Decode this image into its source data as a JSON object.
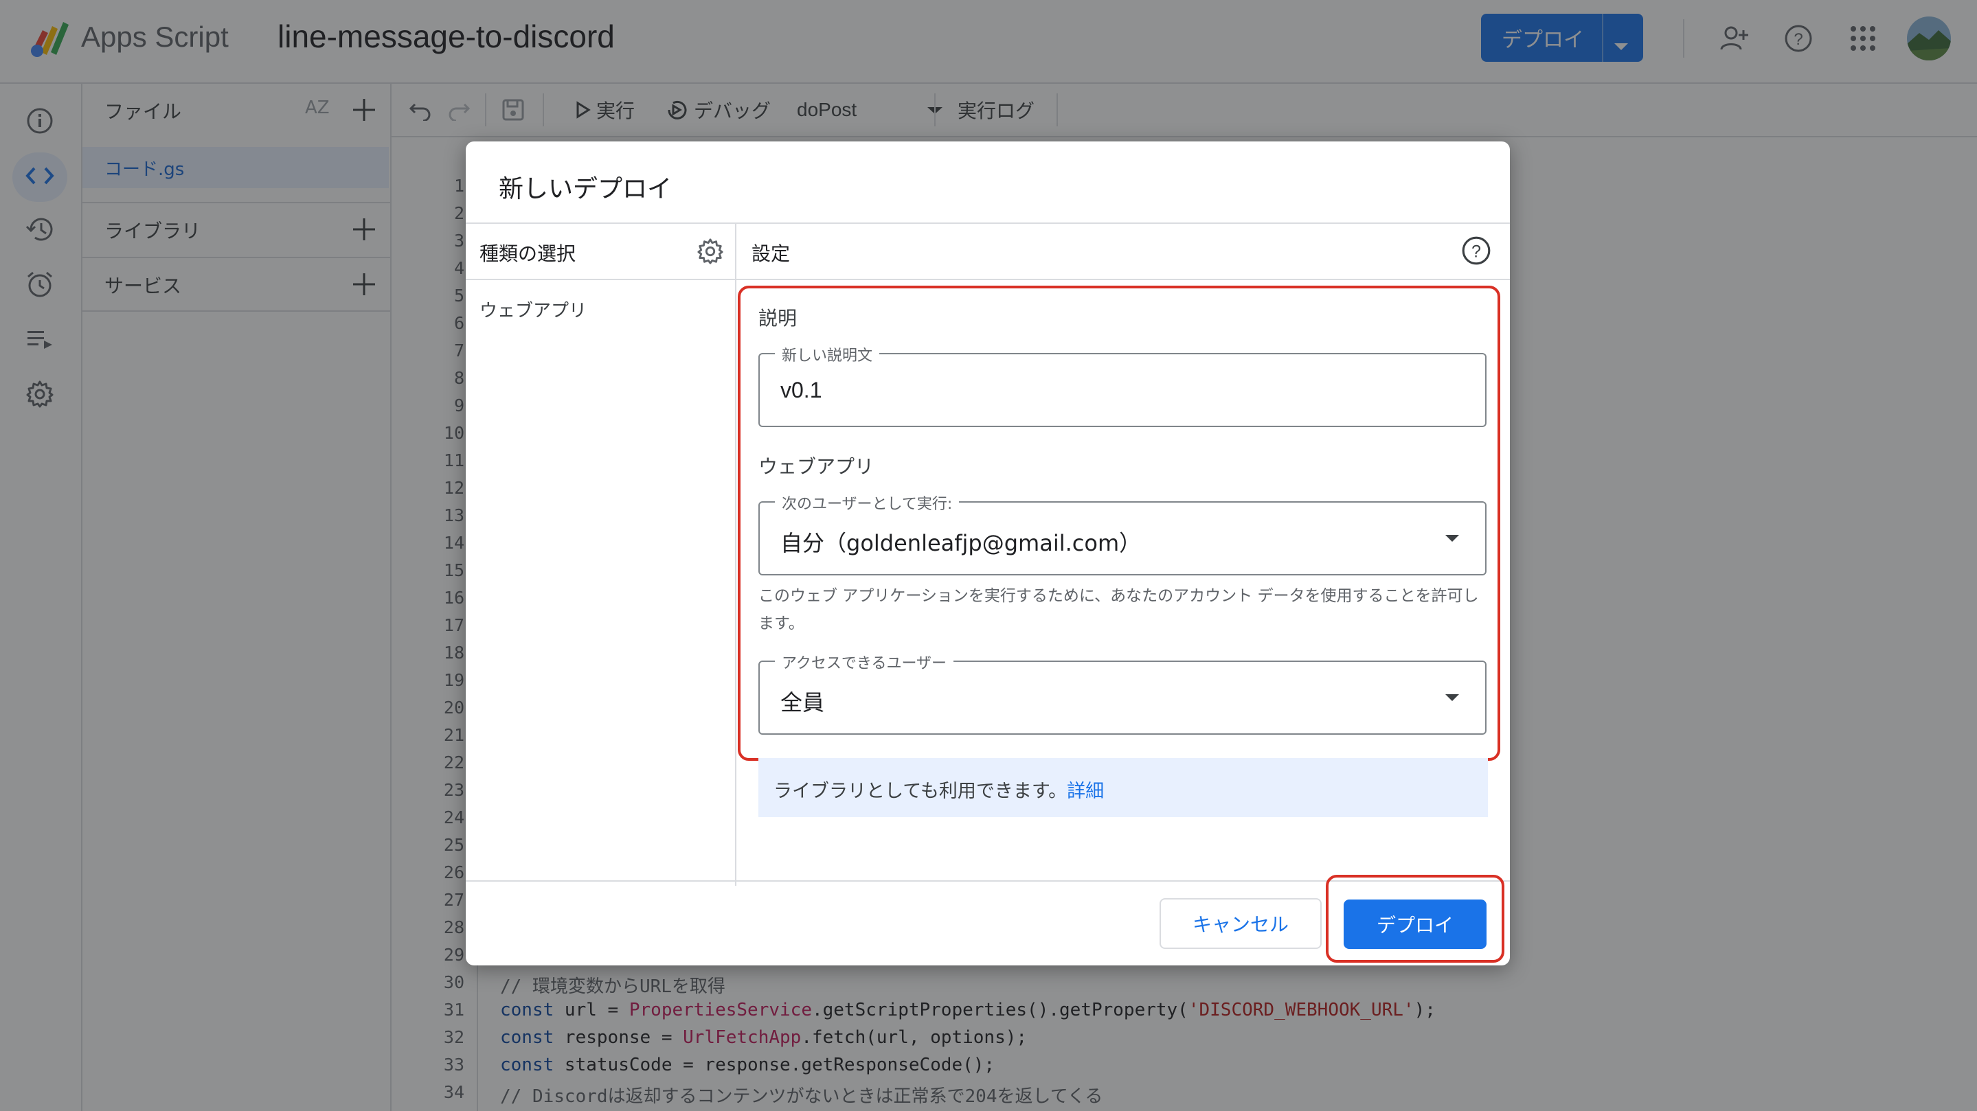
{
  "header": {
    "app_name": "Apps Script",
    "project_title": "line-message-to-discord",
    "deploy_label": "デプロイ",
    "icons": [
      "add-person-icon",
      "help-icon",
      "apps-grid-icon",
      "avatar"
    ]
  },
  "rail": {
    "items": [
      "info-icon",
      "code-icon",
      "history-icon",
      "alarm-icon",
      "executions-icon",
      "settings-icon"
    ],
    "active": "code-icon"
  },
  "file_panel": {
    "files_label": "ファイル",
    "sort_label": "AZ",
    "files": [
      {
        "name": "コード.gs",
        "selected": true
      }
    ],
    "libraries_label": "ライブラリ",
    "services_label": "サービス"
  },
  "toolbar": {
    "run_label": "実行",
    "debug_label": "デバッグ",
    "function_name": "doPost",
    "log_label": "実行ログ"
  },
  "editor": {
    "line_numbers": [
      "1",
      "2",
      "3",
      "4",
      "5",
      "6",
      "7",
      "8",
      "9",
      "10",
      "11",
      "12",
      "13",
      "14",
      "15",
      "16",
      "17",
      "18",
      "19",
      "20",
      "21",
      "22",
      "23",
      "24",
      "25",
      "26",
      "27",
      "28",
      "29",
      "30",
      "31",
      "32",
      "33",
      "34"
    ],
    "code_lines": [
      {
        "line": "30",
        "parts": [
          {
            "t": "// 環境変数からURLを取得",
            "c": "cm"
          }
        ]
      },
      {
        "line": "31",
        "parts": [
          {
            "t": "const",
            "c": "kw"
          },
          {
            "t": " url = ",
            "c": ""
          },
          {
            "t": "PropertiesService",
            "c": "cls"
          },
          {
            "t": ".getScriptProperties().getProperty(",
            "c": ""
          },
          {
            "t": "'DISCORD_WEBHOOK_URL'",
            "c": "str"
          },
          {
            "t": ");",
            "c": ""
          }
        ]
      },
      {
        "line": "32",
        "parts": [
          {
            "t": "const",
            "c": "kw"
          },
          {
            "t": " response = ",
            "c": ""
          },
          {
            "t": "UrlFetchApp",
            "c": "cls"
          },
          {
            "t": ".fetch(url, options);",
            "c": ""
          }
        ]
      },
      {
        "line": "33",
        "parts": [
          {
            "t": "const",
            "c": "kw"
          },
          {
            "t": " statusCode = response.getResponseCode();",
            "c": ""
          }
        ]
      },
      {
        "line": "34",
        "parts": [
          {
            "t": "// Discordは返却するコンテンツがないときは正常系で204を返してくる",
            "c": "cm"
          }
        ]
      }
    ]
  },
  "dialog": {
    "title": "新しいデプロイ",
    "type_select_label": "種類の選択",
    "type_items": [
      "ウェブアプリ"
    ],
    "settings_label": "設定",
    "description_section": "説明",
    "description_field_label": "新しい説明文",
    "description_value": "v0.1",
    "webapp_section": "ウェブアプリ",
    "execute_as_label": "次のユーザーとして実行:",
    "execute_as_value": "自分（goldenleafjp@gmail.com）",
    "execute_as_hint": "このウェブ アプリケーションを実行するために、あなたのアカウント データを使用することを許可します。",
    "access_label": "アクセスできるユーザー",
    "access_value": "全員",
    "library_note": "ライブラリとしても利用できます。",
    "library_link": "詳細",
    "cancel_label": "キャンセル",
    "deploy_label": "デプロイ"
  },
  "colors": {
    "accent": "#1a73e8",
    "highlight": "#d93025",
    "scrim": "rgba(32,33,36,0.5)"
  }
}
